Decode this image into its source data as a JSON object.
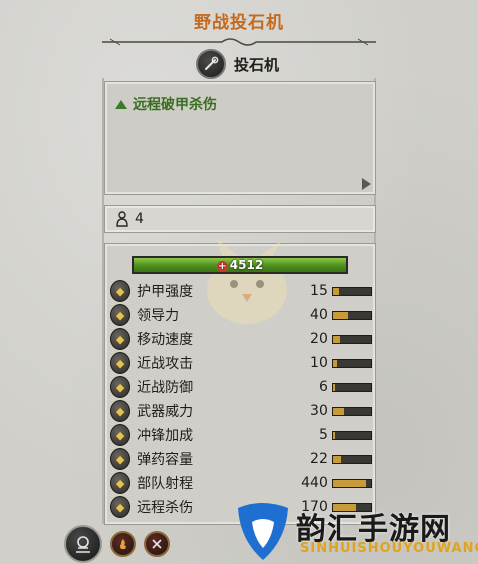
{
  "title": "野战投石机",
  "unit": {
    "name": "投石机"
  },
  "ability": {
    "text": "远程破甲杀伤"
  },
  "men": {
    "count": "4"
  },
  "health": {
    "value": "4512"
  },
  "stats": [
    {
      "label": "护甲强度",
      "value": "15",
      "icon": "armor-icon",
      "fill": 0.15
    },
    {
      "label": "领导力",
      "value": "40",
      "icon": "leadership-icon",
      "fill": 0.4
    },
    {
      "label": "移动速度",
      "value": "20",
      "icon": "speed-icon",
      "fill": 0.2
    },
    {
      "label": "近战攻击",
      "value": "10",
      "icon": "melee-attack-icon",
      "fill": 0.1
    },
    {
      "label": "近战防御",
      "value": "6",
      "icon": "melee-defense-icon",
      "fill": 0.06
    },
    {
      "label": "武器威力",
      "value": "30",
      "icon": "weapon-strength-icon",
      "fill": 0.3
    },
    {
      "label": "冲锋加成",
      "value": "5",
      "icon": "charge-bonus-icon",
      "fill": 0.05
    },
    {
      "label": "弹药容量",
      "value": "22",
      "icon": "ammunition-icon",
      "fill": 0.22
    },
    {
      "label": "部队射程",
      "value": "440",
      "icon": "range-icon",
      "fill": 0.88
    },
    {
      "label": "远程杀伤",
      "value": "170",
      "icon": "missile-damage-icon",
      "fill": 0.6
    }
  ],
  "watermark": {
    "name": "韵汇手游网",
    "sub": "SINHUISHOUYOUWANG"
  },
  "colors": {
    "title": "#c46a1f",
    "ability": "#3a6e22",
    "health": "#4c8f1e",
    "bar_fill": "#c79a3a"
  }
}
